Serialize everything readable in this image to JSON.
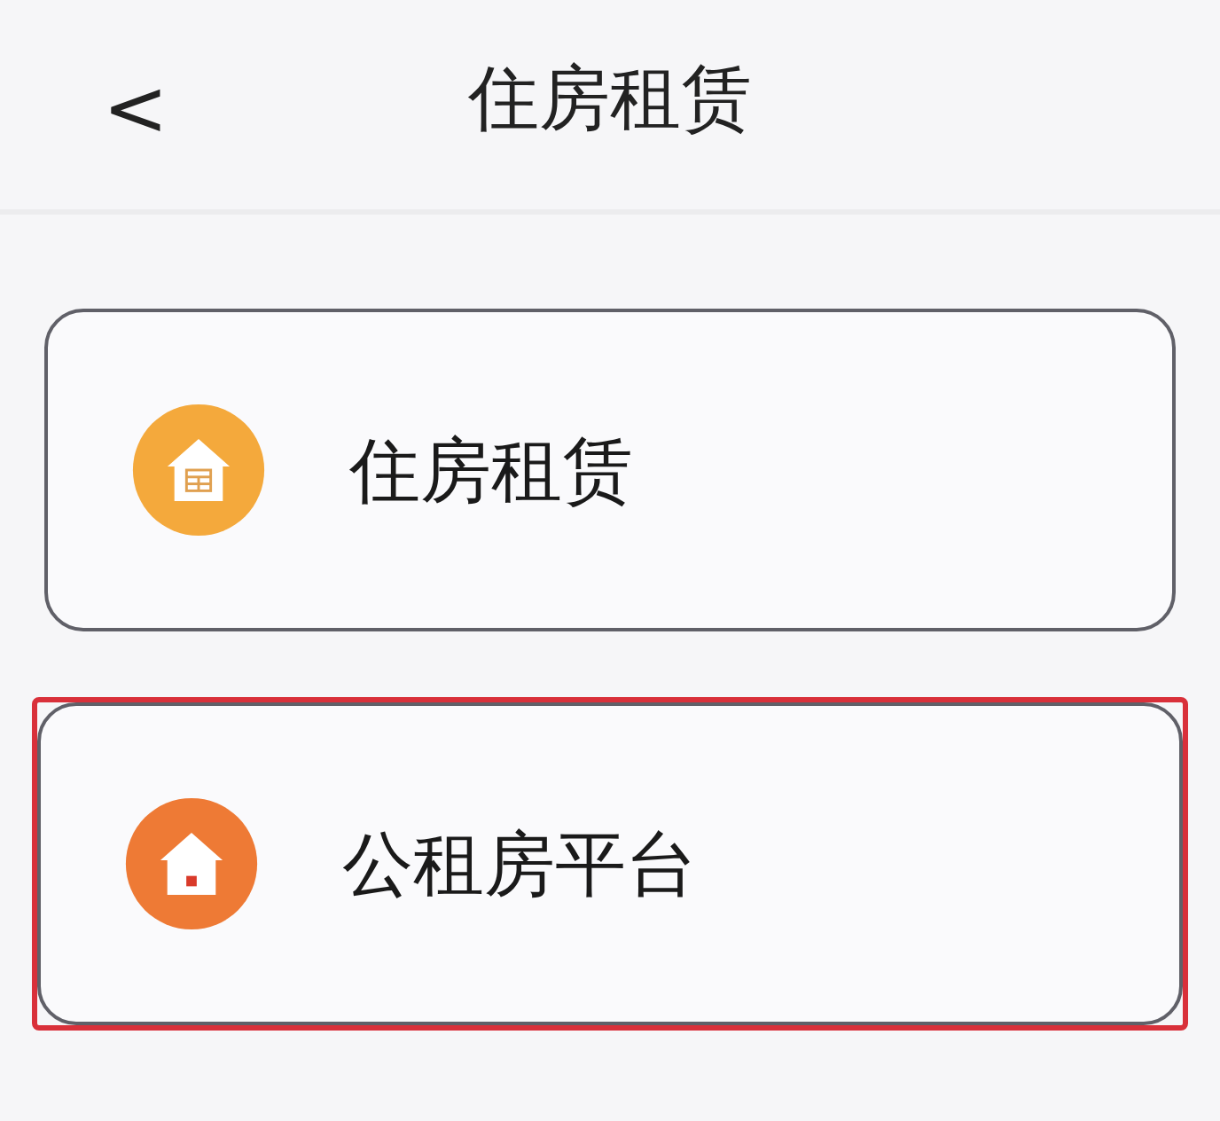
{
  "header": {
    "back": "<",
    "title": "住房租赁"
  },
  "items": [
    {
      "label": "住房租赁",
      "kind": "house-grid",
      "color": "#f4a93c",
      "highlighted": false
    },
    {
      "label": "公租房平台",
      "kind": "house-door",
      "color": "#ee7a35",
      "highlighted": true
    }
  ]
}
